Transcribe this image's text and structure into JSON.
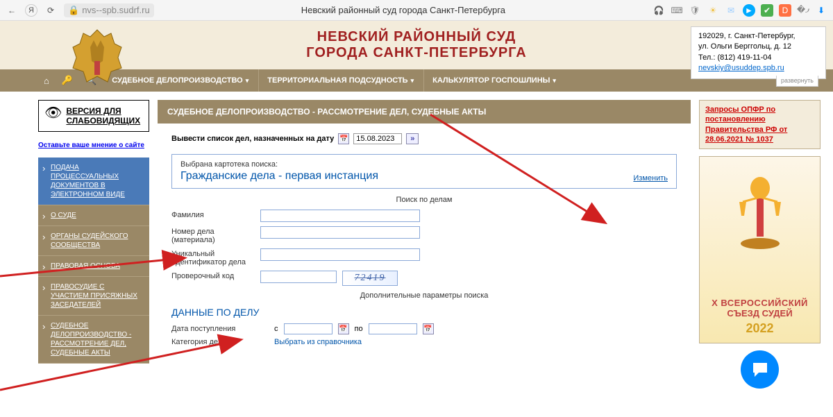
{
  "browser": {
    "url": "nvs--spb.sudrf.ru",
    "tab_title": "Невский районный суд города Санкт-Петербурга"
  },
  "header": {
    "title_line1": "НЕВСКИЙ РАЙОННЫЙ СУД",
    "title_line2": "ГОРОДА САНКТ-ПЕТЕРБУРГА",
    "contact": {
      "address1": "192029, г. Санкт-Петербург,",
      "address2": "ул. Ольги Берггольц, д. 12",
      "phone": "Тел.: (812) 419-11-04",
      "email": "nevskiy@usuddep.spb.ru",
      "expand": "развернуть"
    }
  },
  "nav": {
    "items": [
      "СУДЕБНОЕ ДЕЛОПРОИЗВОДСТВО",
      "ТЕРРИТОРИАЛЬНАЯ ПОДСУДНОСТЬ",
      "КАЛЬКУЛЯТОР ГОСПОШЛИНЫ"
    ]
  },
  "sidebar": {
    "vision": "ВЕРСИЯ ДЛЯ СЛАБОВИДЯЩИХ",
    "feedback": "Оставьте ваше мнение о сайте",
    "menu": [
      "ПОДАЧА ПРОЦЕССУАЛЬНЫХ ДОКУМЕНТОВ В ЭЛЕКТРОННОМ ВИДЕ",
      "О СУДЕ",
      "ОРГАНЫ СУДЕЙСКОГО СООБЩЕСТВА",
      "ПРАВОВАЯ ОСНОВА",
      "ПРАВОСУДИЕ С УЧАСТИЕМ ПРИСЯЖНЫХ ЗАСЕДАТЕЛЕЙ",
      "СУДЕБНОЕ ДЕЛОПРОИЗВОДСТВО - РАССМОТРЕНИЕ ДЕЛ, СУДЕБНЫЕ АКТЫ"
    ]
  },
  "content": {
    "breadcrumb": "СУДЕБНОЕ ДЕЛОПРОИЗВОДСТВО - РАССМОТРЕНИЕ ДЕЛ, СУДЕБНЫЕ АКТЫ",
    "date_label": "Вывести список дел, назначенных на дату",
    "date_value": "15.08.2023",
    "card_label": "Выбрана картотека поиска:",
    "selected_index": "Гражданские дела - первая инстанция",
    "change": "Изменить",
    "search_title": "Поиск по делам",
    "fields": {
      "surname": "Фамилия",
      "case_no": "Номер дела (материала)",
      "uid": "Уникальный идентификатор дела",
      "captcha": "Проверочный код",
      "captcha_value": "72419"
    },
    "extra_title": "Дополнительные параметры поиска",
    "data_title": "ДАННЫЕ ПО ДЕЛУ",
    "date_received": "Дата поступления",
    "from": "с",
    "to": "по",
    "category": "Категория дела",
    "pick_ref": "Выбрать из справочника"
  },
  "right": {
    "notice": "Запросы ОПФР по постановлению Правительства РФ от 28.06.2021 № 1037",
    "banner_title": "X ВСЕРОССИЙСКИЙ",
    "banner_sub": "СЪЕЗД СУДЕЙ",
    "banner_year": "2022"
  }
}
